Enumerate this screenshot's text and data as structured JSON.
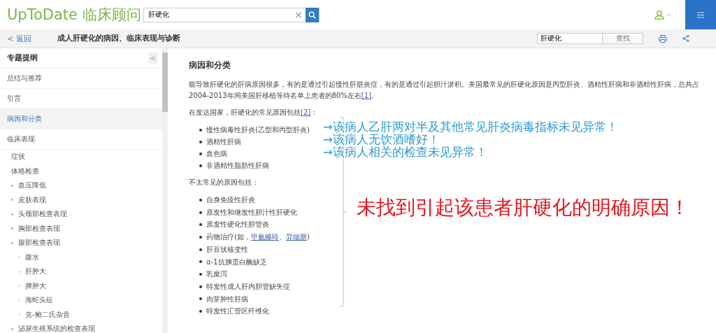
{
  "header": {
    "logo": "UpToDate 临床顾问",
    "search": {
      "value": "肝硬化",
      "clear": "×"
    }
  },
  "toolbar": {
    "back": "< 返回",
    "title": "成人肝硬化的病因、临床表现与诊断",
    "find": {
      "value": "肝硬化",
      "button": "查找"
    }
  },
  "sidebar": {
    "title": "专题提纲",
    "collapse": "<",
    "items": [
      {
        "label": "总结与推荐",
        "selected": false
      },
      {
        "label": "引言",
        "selected": false
      },
      {
        "label": "病因和分类",
        "selected": true
      },
      {
        "label": "临床表现",
        "selected": false,
        "children": [
          {
            "label": "症状",
            "selected": false
          },
          {
            "label": "体格检查",
            "selected": false,
            "children": [
              {
                "label": "血压降低",
                "selected": false
              },
              {
                "label": "皮肤表现",
                "selected": false
              },
              {
                "label": "头颈部检查表现",
                "selected": false
              },
              {
                "label": "胸部检查表现",
                "selected": false
              },
              {
                "label": "腹部检查表现",
                "selected": false,
                "children": [
                  {
                    "label": "腹水",
                    "selected": false
                  },
                  {
                    "label": "肝肿大",
                    "selected": false
                  },
                  {
                    "label": "脾肿大",
                    "selected": false
                  },
                  {
                    "label": "海蛇头征",
                    "selected": false
                  },
                  {
                    "label": "克-鲍二氏杂音",
                    "selected": false
                  }
                ]
              },
              {
                "label": "泌尿生殖系统的检查表现",
                "selected": false
              }
            ]
          }
        ]
      }
    ]
  },
  "article": {
    "heading": "病因和分类",
    "intro": {
      "text": "能导致肝硬化的肝病原因很多，有的是通过引起慢性肝脏炎症，有的是通过引起胆汁淤积。美国最常见的肝硬化原因是丙型肝炎、酒精性肝病和非酒精性肝病，总共占2004-2013年间美国肝移植等待名单上患者的80%左右",
      "ref": "[1]",
      "end": "。"
    },
    "common_lead": {
      "text": "在发达国家，肝硬化的常见原因包括",
      "ref": "[2]",
      "end": "："
    },
    "common": [
      {
        "parts": [
          {
            "text": "慢性病毒性肝炎(乙型和丙型肝炎)"
          }
        ]
      },
      {
        "parts": [
          {
            "text": "酒精性肝病"
          }
        ]
      },
      {
        "parts": [
          {
            "text": "血色病"
          }
        ]
      },
      {
        "parts": [
          {
            "text": "非酒精性脂肪性肝病"
          }
        ]
      }
    ],
    "rare_lead": {
      "text": "不太常见的原因包括："
    },
    "rare": [
      {
        "parts": [
          {
            "text": "自身免疫性肝炎"
          }
        ]
      },
      {
        "parts": [
          {
            "text": "原发性和继发性胆汁性肝硬化"
          }
        ]
      },
      {
        "parts": [
          {
            "text": "原发性硬化性胆管炎"
          }
        ]
      },
      {
        "parts": [
          {
            "text": "药物治疗(如，"
          },
          {
            "text": "甲氨蝶呤",
            "link": true
          },
          {
            "text": "、"
          },
          {
            "text": "异烟肼",
            "link": true
          },
          {
            "text": ")"
          }
        ]
      },
      {
        "parts": [
          {
            "text": "肝豆状核变性"
          }
        ]
      },
      {
        "parts": [
          {
            "text": "α-1抗胰蛋白酶缺乏"
          }
        ]
      },
      {
        "parts": [
          {
            "text": "乳糜泻"
          }
        ]
      },
      {
        "parts": [
          {
            "text": "特发性成人肝内胆管缺失症"
          }
        ]
      },
      {
        "parts": [
          {
            "text": "肉芽肿性肝病"
          }
        ]
      },
      {
        "parts": [
          {
            "text": "特发性汇管区纤维化"
          }
        ]
      }
    ]
  },
  "annotations": {
    "notes": [
      "→该病人乙肝两对半及其他常见肝炎病毒指标未见异常！",
      "→该病人无饮酒嗜好！",
      "→该病人相关的检查未见异常！"
    ],
    "conclusion": "未找到引起该患者肝硬化的明确原因！"
  }
}
